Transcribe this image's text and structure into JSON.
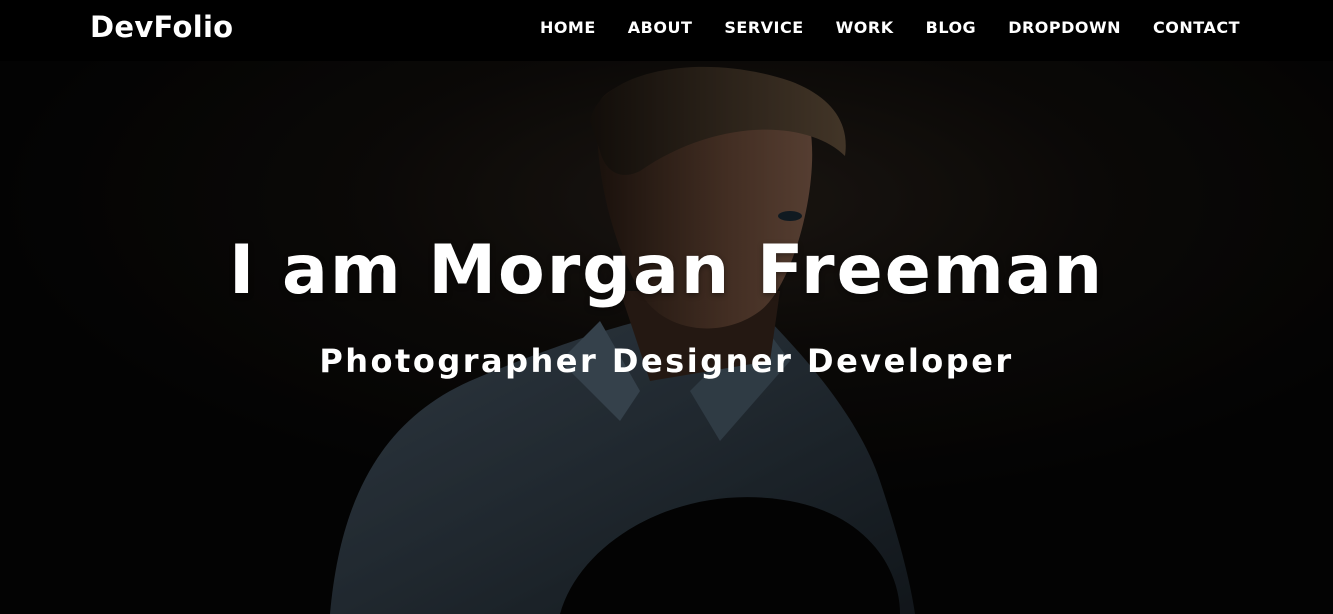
{
  "navbar": {
    "brand": "DevFolio",
    "items": [
      {
        "label": "HOME"
      },
      {
        "label": "ABOUT"
      },
      {
        "label": "SERVICE"
      },
      {
        "label": "WORK"
      },
      {
        "label": "BLOG"
      },
      {
        "label": "DROPDOWN"
      },
      {
        "label": "CONTACT"
      }
    ]
  },
  "hero": {
    "title": "I am Morgan Freeman",
    "subtitle": "Photographer Designer Developer"
  },
  "colors": {
    "navbar_bg": "#000000",
    "hero_bg": "#070707",
    "text": "#ffffff"
  },
  "icons": []
}
